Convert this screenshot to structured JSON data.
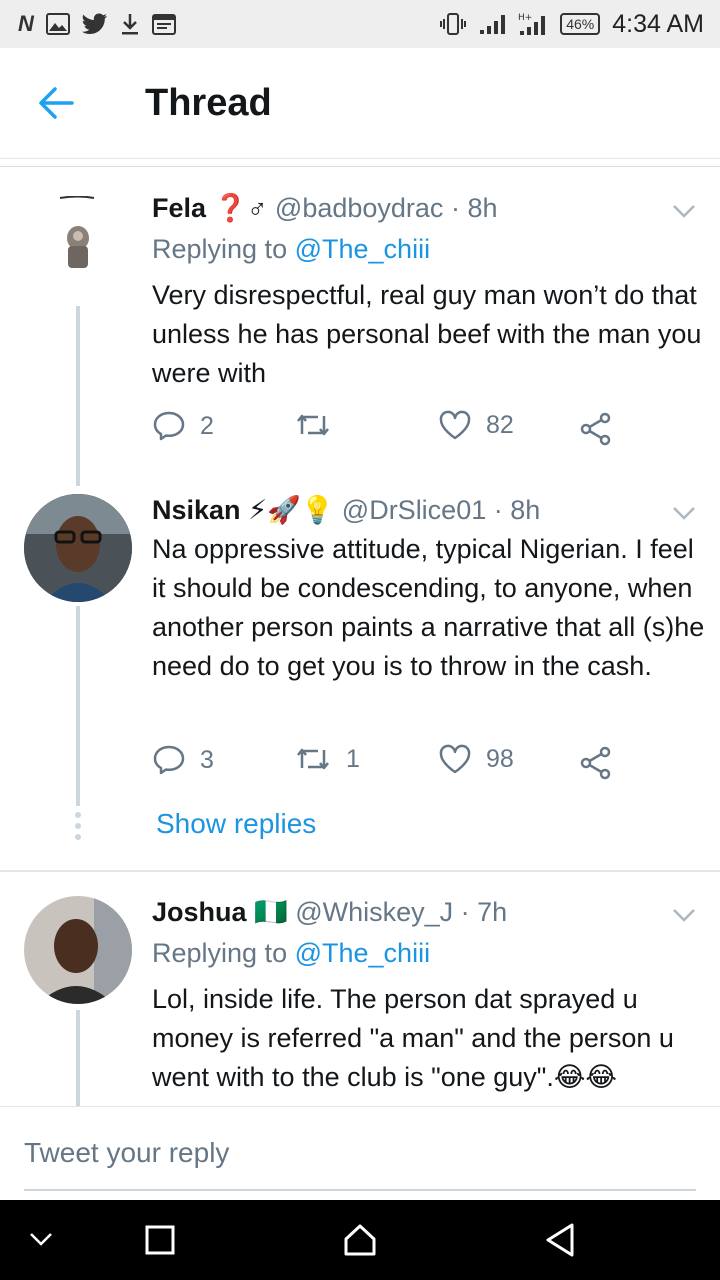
{
  "status": {
    "time": "4:34 AM",
    "battery": "46%",
    "left_icons": [
      "N",
      "gallery-icon",
      "twitter-icon",
      "download-icon",
      "calendar-icon"
    ]
  },
  "header": {
    "title": "Thread"
  },
  "tweets": [
    {
      "name": "Fela ❓♂",
      "handle": "@badboydrac",
      "time": "· 8h",
      "replying_prefix": "Replying to",
      "replying_to": "@The_chiii",
      "text": "Very disrespectful, real guy man won’t do that unless he has personal beef with the man you were with",
      "replies": "2",
      "retweets": "",
      "likes": "82"
    },
    {
      "name": "Nsikan",
      "emojis": "⚡🚀💡",
      "handle": "@DrSlice01",
      "time": "· 8h",
      "text": "Na oppressive attitude, typical Nigerian. I feel it should be condescending, to anyone, when another person paints a narrative that all (s)he need do to get you is to throw in the cash.",
      "replies": "3",
      "retweets": "1",
      "likes": "98"
    },
    {
      "name": "Joshua",
      "emojis": "🇳🇬",
      "handle": "@Whiskey_J",
      "time": "· 7h",
      "replying_prefix": "Replying to",
      "replying_to": "@The_chiii",
      "text": "Lol, inside life. The person dat sprayed u money is referred \"a man\" and the person u went with to the club is \"one guy\".😂😂"
    }
  ],
  "show_replies": "Show replies",
  "reply_placeholder": "Tweet your reply",
  "colors": {
    "link": "#1b95e0",
    "muted": "#657786",
    "text": "#14171a"
  }
}
